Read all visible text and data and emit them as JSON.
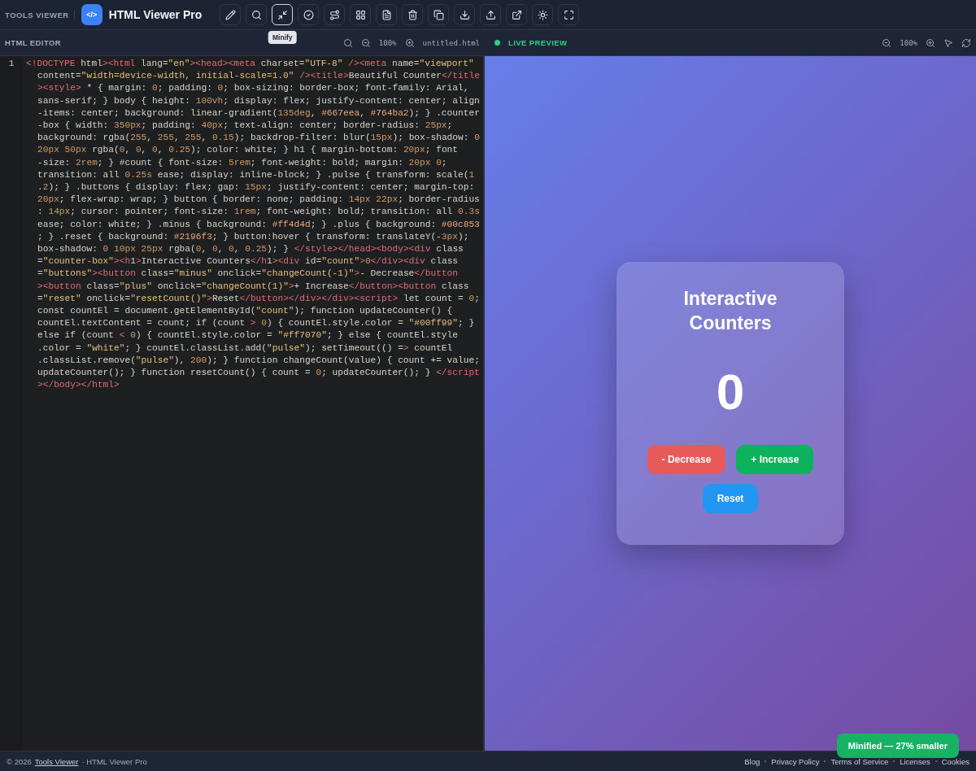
{
  "app": {
    "brand": "TOOLS VIEWER",
    "title": "HTML Viewer Pro",
    "logo": "</>"
  },
  "toolbar": {
    "tools": [
      {
        "selected": false
      },
      {
        "selected": false
      },
      {
        "selected": true
      },
      {
        "selected": false
      },
      {
        "selected": false
      },
      {
        "selected": false
      },
      {
        "selected": false
      },
      {
        "selected": false
      },
      {
        "selected": false
      },
      {
        "selected": false
      },
      {
        "selected": false
      },
      {
        "selected": false
      },
      {
        "selected": false
      },
      {
        "selected": false
      }
    ],
    "tooltip": "Minify"
  },
  "editor": {
    "title": "HTML EDITOR",
    "zoom": "100%",
    "filename": "untitled.html",
    "line_number": "1",
    "lines": [
      "<!DOCTYPE html><html lang=\"en\"><head><meta charset=\"UTF-8\" /><meta name=\"viewport\"",
      "content=\"width=device-width, initial-scale=1.0\" /><title>Beautiful Counter</title",
      "><style> * { margin: 0; padding: 0; box-sizing: border-box; font-family: Arial,",
      "sans-serif; } body { height: 100vh; display: flex; justify-content: center; align",
      "-items: center; background: linear-gradient(135deg, #667eea, #764ba2); } .counter",
      "-box { width: 350px; padding: 40px; text-align: center; border-radius: 25px;",
      "background: rgba(255, 255, 255, 0.15); backdrop-filter: blur(15px); box-shadow: 0",
      "20px 50px rgba(0, 0, 0, 0.25); color: white; } h1 { margin-bottom: 20px; font",
      "-size: 2rem; } #count { font-size: 5rem; font-weight: bold; margin: 20px 0;",
      "transition: all 0.25s ease; display: inline-block; } .pulse { transform: scale(1",
      ".2); } .buttons { display: flex; gap: 15px; justify-content: center; margin-top:",
      "20px; flex-wrap: wrap; } button { border: none; padding: 14px 22px; border-radius",
      ": 14px; cursor: pointer; font-size: 1rem; font-weight: bold; transition: all 0.3s",
      "ease; color: white; } .minus { background: #ff4d4d; } .plus { background: #00c853",
      "; } .reset { background: #2196f3; } button:hover { transform: translateY(-3px);",
      "box-shadow: 0 10px 25px rgba(0, 0, 0, 0.25); } </style></head><body><div class",
      "=\"counter-box\"><h1>Interactive Counters</h1><div id=\"count\">0</div><div class",
      "=\"buttons\"><button class=\"minus\" onclick=\"changeCount(-1)\">- Decrease</button",
      "><button class=\"plus\" onclick=\"changeCount(1)\">+ Increase</button><button class",
      "=\"reset\" onclick=\"resetCount()\">Reset</button></div></div><script> let count = 0;",
      "const countEl = document.getElementById(\"count\"); function updateCounter() {",
      "countEl.textContent = count; if (count > 0) { countEl.style.color = \"#00ff99\"; }",
      "else if (count < 0) { countEl.style.color = \"#ff7070\"; } else { countEl.style",
      ".color = \"white\"; } countEl.classList.add(\"pulse\"); setTimeout(() => countEl",
      ".classList.remove(\"pulse\"), 200); } function changeCount(value) { count += value;",
      "updateCounter(); } function resetCount() { count = 0; updateCounter(); } </script",
      "></body></html>"
    ]
  },
  "preview": {
    "title": "LIVE PREVIEW",
    "live": true,
    "zoom": "100%",
    "card": {
      "heading": "Interactive Counters",
      "count": "0",
      "buttons": [
        {
          "label": "- Decrease",
          "color": "#e85a5a"
        },
        {
          "label": "+ Increase",
          "color": "#0db25c"
        },
        {
          "label": "Reset",
          "color": "#2196f3"
        }
      ]
    }
  },
  "toast": "Minified — 27% smaller",
  "footer": {
    "copyright": "© 2026",
    "link": "Tools Viewer",
    "suffix": "· HTML Viewer Pro",
    "links": [
      "Blog",
      "Privacy Policy",
      "Terms of Service",
      "Licenses",
      "Cookies"
    ]
  }
}
